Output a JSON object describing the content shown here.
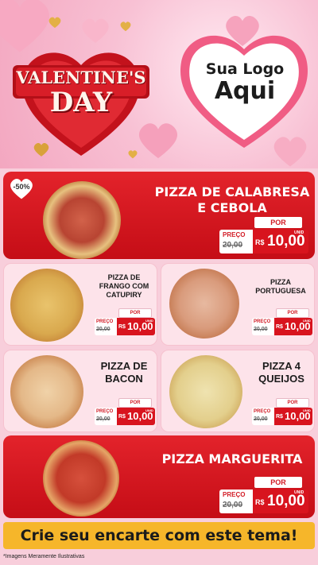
{
  "banner": {
    "title_line1": "VALENTINE'S",
    "title_line2": "DAY",
    "logo_line1": "Sua Logo",
    "logo_line2": "Aqui"
  },
  "discount_badge": "-50%",
  "products": [
    {
      "name": "PIZZA DE CALABRESA E CEBOLA",
      "preco_label": "PREÇO",
      "old_price": "20,00",
      "por_label": "POR",
      "currency": "R$",
      "price": "10,00",
      "unit": "UNID"
    },
    {
      "name": "PIZZA DE FRANGO COM CATUPIRY",
      "preco_label": "PREÇO",
      "old_price": "20,00",
      "por_label": "POR",
      "currency": "R$",
      "price": "10,00",
      "unit": "UNID"
    },
    {
      "name": "PIZZA PORTUGUESA",
      "preco_label": "PREÇO",
      "old_price": "20,00",
      "por_label": "POR",
      "currency": "R$",
      "price": "10,00",
      "unit": "UNID"
    },
    {
      "name": "PIZZA DE BACON",
      "preco_label": "PREÇO",
      "old_price": "20,00",
      "por_label": "POR",
      "currency": "R$",
      "price": "10,00",
      "unit": "UNID"
    },
    {
      "name": "PIZZA 4 QUEIJOS",
      "preco_label": "PREÇO",
      "old_price": "20,00",
      "por_label": "POR",
      "currency": "R$",
      "price": "10,00",
      "unit": "UNID"
    },
    {
      "name": "PIZZA MARGUERITA",
      "preco_label": "PREÇO",
      "old_price": "20,00",
      "por_label": "POR",
      "currency": "R$",
      "price": "10,00",
      "unit": "UNID"
    }
  ],
  "cta": "Crie seu encarte com este tema!",
  "footnote": "*Imagens Meramente Ilustrativas",
  "colors": {
    "red": "#d8141e",
    "pink_card": "#fde3ea",
    "cta": "#f6b62a"
  }
}
